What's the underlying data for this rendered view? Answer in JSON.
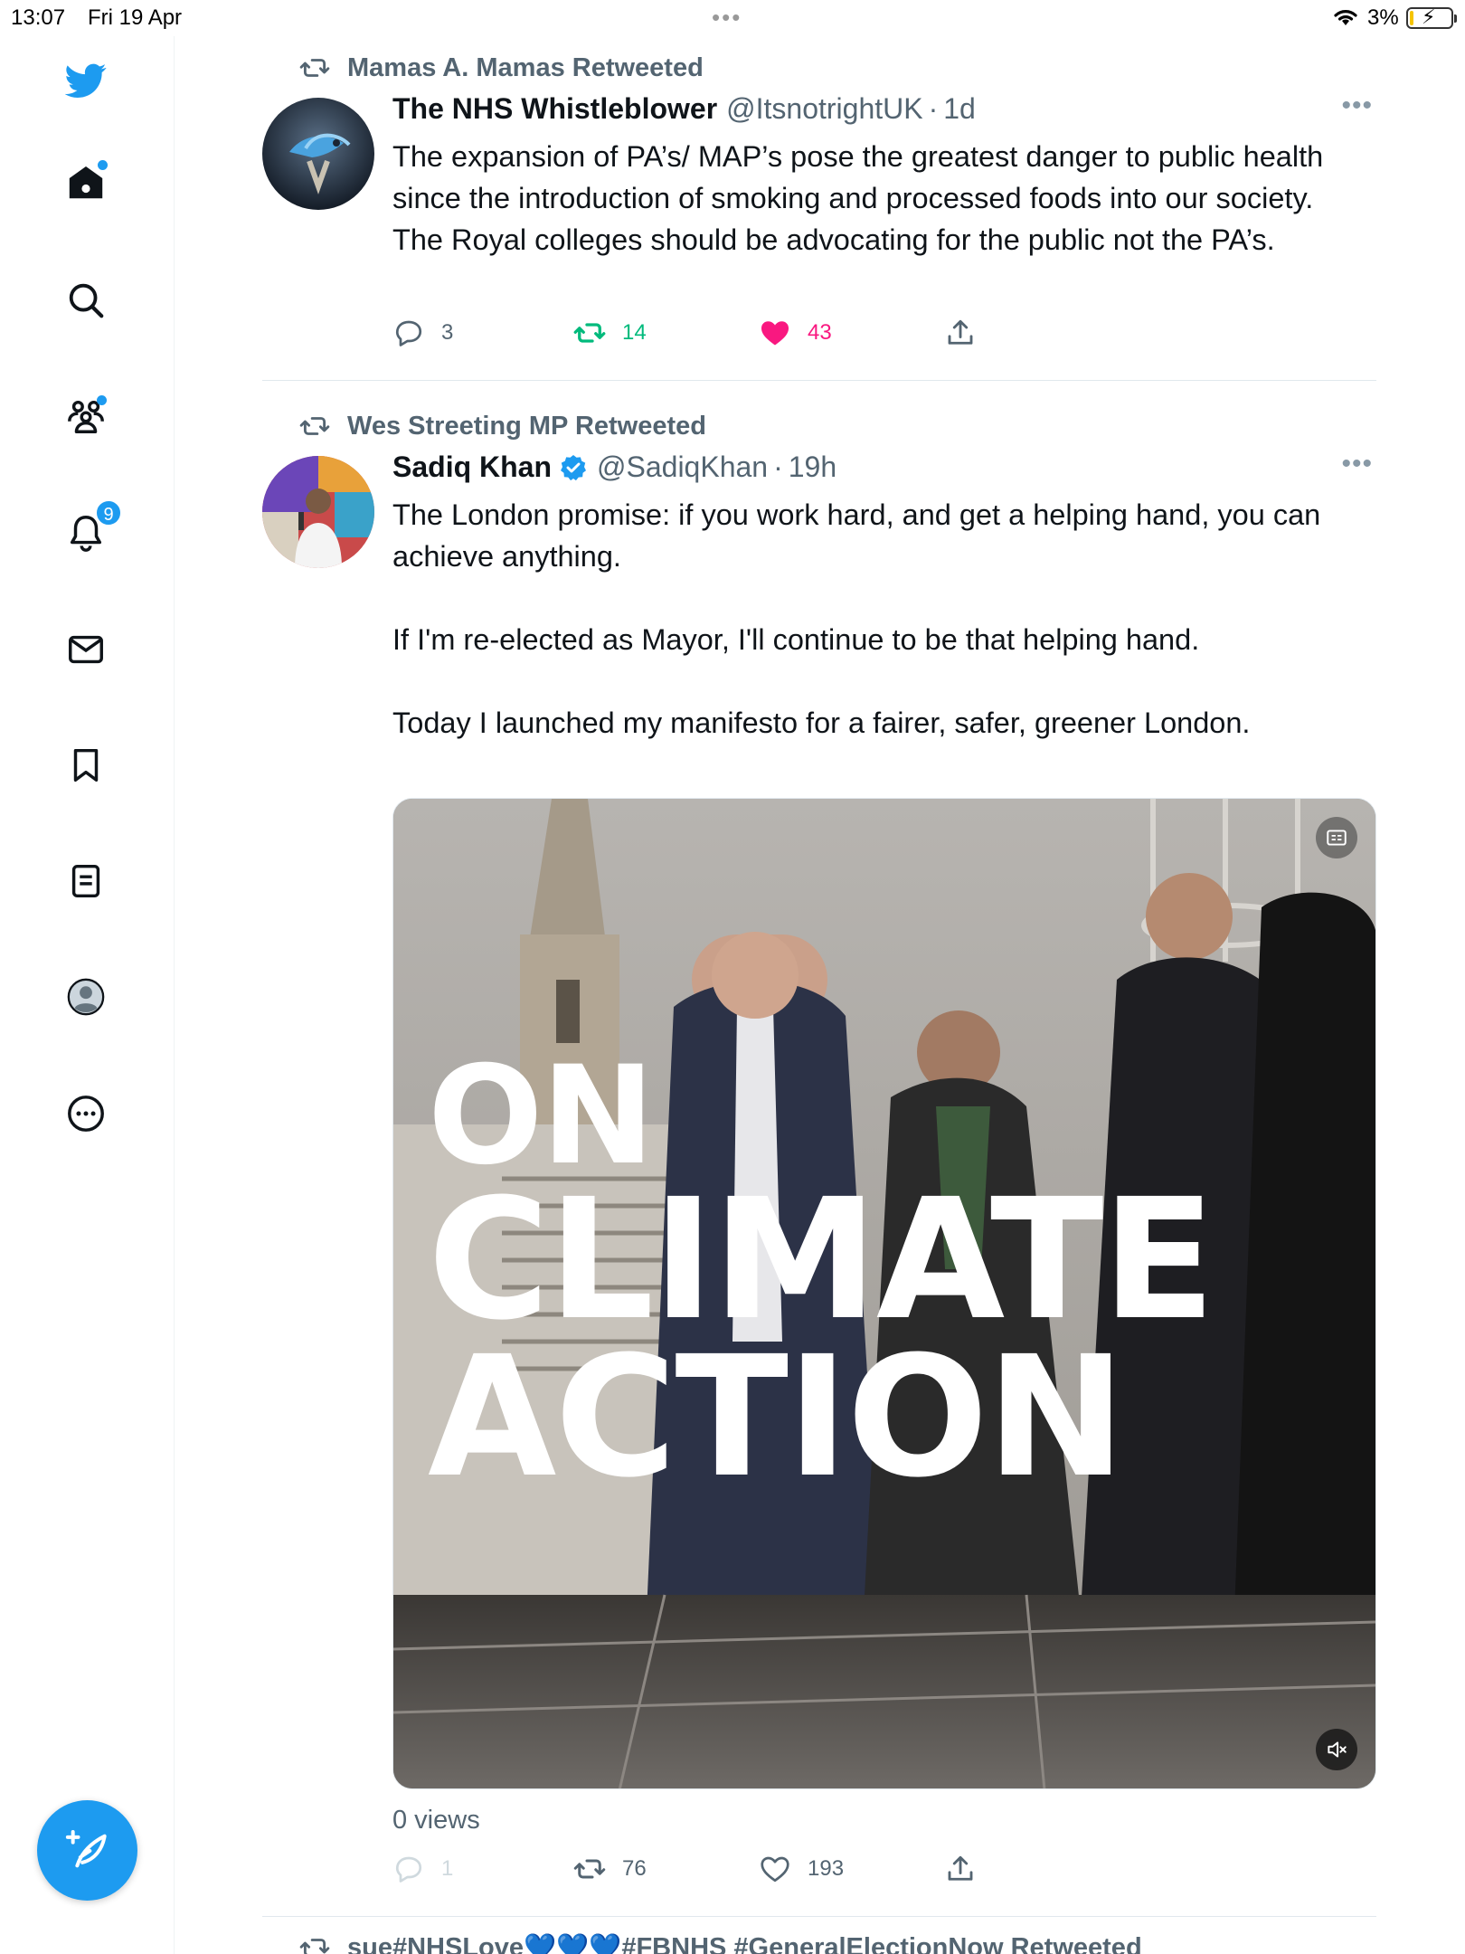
{
  "status_bar": {
    "time": "13:07",
    "date": "Fri 19 Apr",
    "battery_percent": "3%",
    "battery_level": 0.03
  },
  "sidebar": {
    "items": [
      {
        "name": "home",
        "icon": "home-icon",
        "has_dot": true
      },
      {
        "name": "explore",
        "icon": "search-icon"
      },
      {
        "name": "communities",
        "icon": "communities-icon",
        "has_dot": true
      },
      {
        "name": "notifications",
        "icon": "bell-icon",
        "badge": "9"
      },
      {
        "name": "messages",
        "icon": "mail-icon"
      },
      {
        "name": "bookmarks",
        "icon": "bookmark-icon"
      },
      {
        "name": "lists",
        "icon": "list-icon"
      },
      {
        "name": "profile",
        "icon": "profile-icon"
      },
      {
        "name": "more",
        "icon": "more-circle-icon"
      }
    ],
    "compose_icon": "compose-feather-icon"
  },
  "tweets": [
    {
      "retweeted_by": "Mamas A. Mamas Retweeted",
      "name": "The NHS Whistleblower",
      "handle": "@ItsnotrightUK",
      "time": "1d",
      "verified": false,
      "text": "The expansion of PA’s/ MAP’s pose the greatest danger to public health since the introduction of smoking and processed foods into our society. The Royal colleges should be advocating for the public not the PA’s.",
      "replies": "3",
      "retweets": "14",
      "likes": "43",
      "liked": true,
      "retweeted": true
    },
    {
      "retweeted_by": "Wes Streeting MP Retweeted",
      "name": "Sadiq Khan",
      "handle": "@SadiqKhan",
      "time": "19h",
      "verified": true,
      "text": "The London promise: if you work hard, and get a helping hand, you can achieve anything.\n\nIf I'm re-elected as Mayor, I'll continue to be that helping hand.\n\nToday I launched my manifesto for a fairer, safer, greener London.",
      "media_overlay": [
        "ON",
        "CLIMATE",
        "ACTION"
      ],
      "views": "0 views",
      "replies": "1",
      "retweets": "76",
      "likes": "193",
      "liked": false,
      "retweeted": false
    },
    {
      "retweeted_by": "sue#NHSLove💙💙💙#FBNHS #GeneralElectionNow Retweeted"
    }
  ],
  "colors": {
    "accent": "#1d9bf0",
    "retweet_green": "#00ba7c",
    "like_pink": "#f91880",
    "secondary_text": "#536471"
  }
}
